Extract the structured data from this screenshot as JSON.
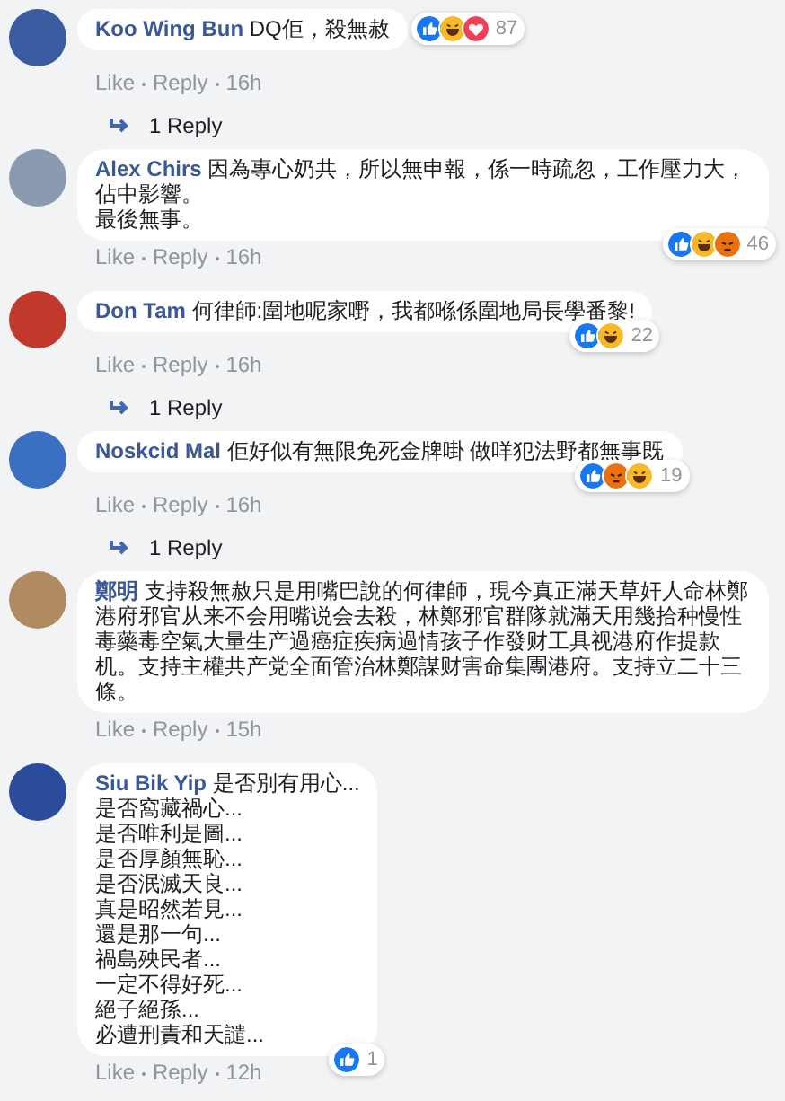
{
  "comments": [
    {
      "author": "Koo Wing Bun",
      "lines": [
        "DQ佢，殺無赦"
      ],
      "reactions": [
        {
          "kind": "like"
        },
        {
          "kind": "haha"
        },
        {
          "kind": "love"
        }
      ],
      "reaction_count": "87",
      "actions": [
        "Like",
        "Reply",
        "16h"
      ],
      "replies": "1 Reply"
    },
    {
      "author": "Alex Chirs",
      "lines": [
        "因為專心奶共，所以無申報，係一時疏忽，工作壓力大，佔中影響。",
        "最後無事。"
      ],
      "reactions": [
        {
          "kind": "like"
        },
        {
          "kind": "haha"
        },
        {
          "kind": "angry"
        }
      ],
      "reaction_count": "46",
      "actions": [
        "Like",
        "Reply",
        "16h"
      ]
    },
    {
      "author": "Don Tam",
      "lines": [
        "何律師:圍地呢家嘢，我都喺係圍地局長學番黎!"
      ],
      "reactions": [
        {
          "kind": "like"
        },
        {
          "kind": "haha"
        }
      ],
      "reaction_count": "22",
      "actions": [
        "Like",
        "Reply",
        "16h"
      ],
      "replies": "1 Reply"
    },
    {
      "author": "Noskcid Mal",
      "lines": [
        "佢好似有無限免死金牌啩 做咩犯法野都無事既"
      ],
      "reactions": [
        {
          "kind": "like"
        },
        {
          "kind": "angry"
        },
        {
          "kind": "haha"
        }
      ],
      "reaction_count": "19",
      "actions": [
        "Like",
        "Reply",
        "16h"
      ],
      "replies": "1 Reply"
    },
    {
      "author": "鄭明",
      "lines": [
        "支持殺無赦只是用嘴巴說的何律師，現今真正滿天草奸人命林鄭港府邪官从来不会用嘴说会去殺，林鄭邪官群隊就滿天用幾拾种慢性毒藥毒空氣大量生产過癌症疾病過情孩子作發财工具视港府作提款机。支持主權共产党全面管治林鄭謀财害命集團港府。支持立二十三條。"
      ],
      "actions": [
        "Like",
        "Reply",
        "15h"
      ]
    },
    {
      "author": "Siu Bik Yip",
      "lines": [
        "是否別有用心...",
        "是否窩藏禍心...",
        "是否唯利是圖...",
        "是否厚顏無恥...",
        "是否泯滅天良...",
        "真是昭然若見...",
        "還是那一句...",
        "禍島殃民者...",
        "一定不得好死...",
        "絕子絕孫...",
        "必遭刑責和天譴..."
      ],
      "reactions": [
        {
          "kind": "like"
        }
      ],
      "reaction_count": "1",
      "actions": [
        "Like",
        "Reply",
        "12h"
      ]
    }
  ]
}
